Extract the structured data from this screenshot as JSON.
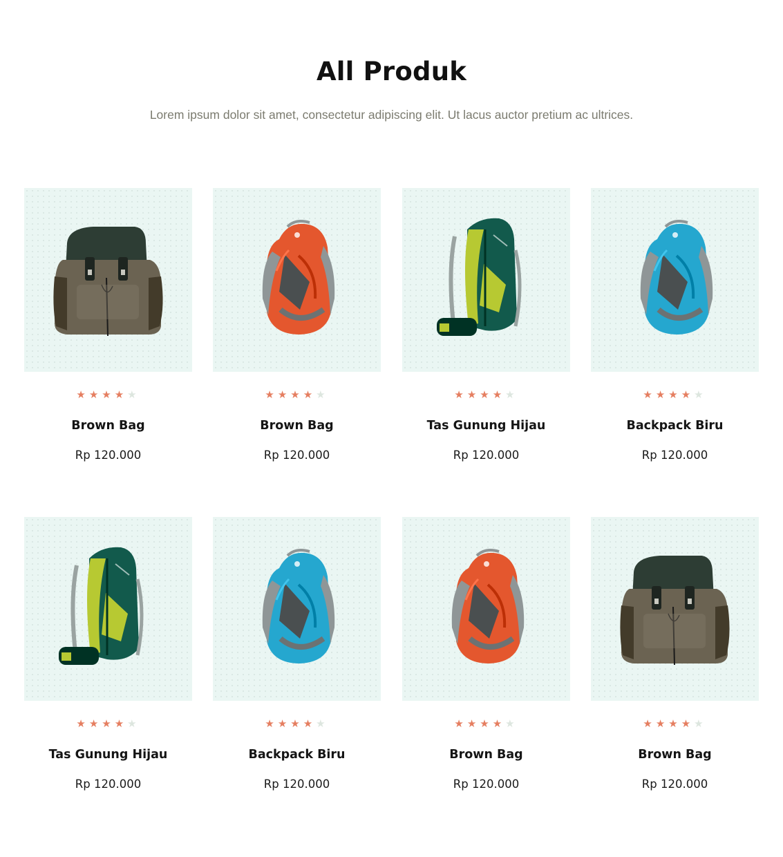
{
  "header": {
    "title": "All Produk",
    "subtitle": "Lorem ipsum dolor sit amet, consectetur adipiscing elit. Ut lacus auctor pretium ac ultrices."
  },
  "products": [
    {
      "name": "Brown Bag",
      "price": "Rp 120.000",
      "rating": 4,
      "rating_max": 5,
      "image": "brown-backpack",
      "color": "#6b6352"
    },
    {
      "name": "Brown Bag",
      "price": "Rp 120.000",
      "rating": 4,
      "rating_max": 5,
      "image": "orange-backpack",
      "color": "#e4572e"
    },
    {
      "name": "Tas Gunung Hijau",
      "price": "Rp 120.000",
      "rating": 4,
      "rating_max": 5,
      "image": "green-hiking-backpack",
      "color": "#125a4c"
    },
    {
      "name": "Backpack Biru",
      "price": "Rp 120.000",
      "rating": 4,
      "rating_max": 5,
      "image": "blue-backpack",
      "color": "#25a7cf"
    },
    {
      "name": "Tas Gunung Hijau",
      "price": "Rp 120.000",
      "rating": 4,
      "rating_max": 5,
      "image": "green-hiking-backpack",
      "color": "#125a4c"
    },
    {
      "name": "Backpack Biru",
      "price": "Rp 120.000",
      "rating": 4,
      "rating_max": 5,
      "image": "blue-backpack",
      "color": "#25a7cf"
    },
    {
      "name": "Brown Bag",
      "price": "Rp 120.000",
      "rating": 4,
      "rating_max": 5,
      "image": "orange-backpack",
      "color": "#e4572e"
    },
    {
      "name": "Brown Bag",
      "price": "Rp 120.000",
      "rating": 4,
      "rating_max": 5,
      "image": "brown-backpack",
      "color": "#6b6352"
    }
  ],
  "colors": {
    "star_active": "#e57e60",
    "star_inactive": "#dde6df",
    "thumb_background": "#eaf6f3"
  }
}
